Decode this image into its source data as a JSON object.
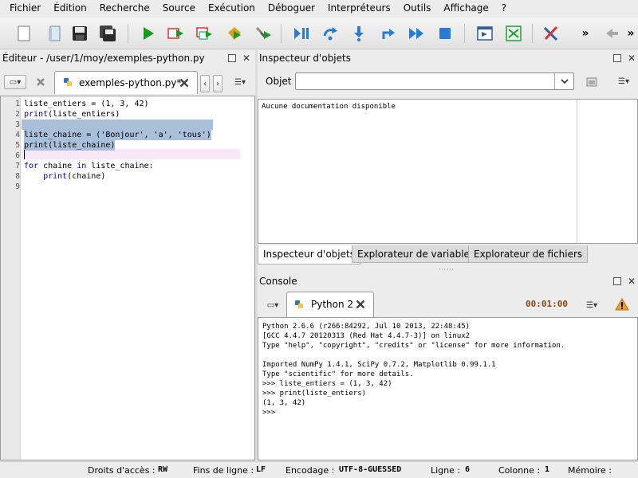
{
  "menubar": {
    "items": [
      "Fichier",
      "Édition",
      "Recherche",
      "Source",
      "Exécution",
      "Déboguer",
      "Interpréteurs",
      "Outils",
      "Affichage",
      "?"
    ]
  },
  "toolbar": {
    "overflow1": "»",
    "overflow2": "»",
    "icons": [
      "new-file-icon",
      "open-file-icon",
      "save-icon",
      "save-all-icon",
      "run-icon",
      "run-cell-icon",
      "run-cell-advance-icon",
      "run-selection-icon",
      "debug-icon",
      "debug-continue-icon",
      "step-icon",
      "step-into-icon",
      "step-return-icon",
      "continue-icon",
      "stop-icon",
      "maximize-icon",
      "pythonpath-icon",
      "tools-icon",
      "back-icon"
    ]
  },
  "editor": {
    "title": "Éditeur - /user/1/moy/exemples-python.py",
    "tab_label": "exemples-python.py*",
    "lines": [
      "1",
      "2",
      "3",
      "4",
      "5",
      "6",
      "7",
      "8",
      "9"
    ],
    "code": {
      "l1": "liste_entiers = (1, 3, 42)",
      "l2a": "print",
      "l2b": "(liste_entiers)",
      "l4": "liste_chaine = ('Bonjour', 'a', 'tous')",
      "l5": "print(liste_chaine)",
      "l7a": "for",
      "l7b": " chaine ",
      "l7c": "in",
      "l7d": " liste_chaine:",
      "l8a": "    ",
      "l8b": "print",
      "l8c": "(chaine)"
    }
  },
  "inspector": {
    "title": "Inspecteur d'objets",
    "object_label": "Objet",
    "object_value": "",
    "doc_text": "Aucune documentation disponible",
    "tabs": [
      "Inspecteur d'objets",
      "Explorateur de variables",
      "Explorateur de fichiers"
    ]
  },
  "console": {
    "title": "Console",
    "tab_label": "Python 2",
    "timer": "00:01:00",
    "lines": [
      "Python 2.6.6 (r266:84292, Jul 10 2013, 22:48:45)",
      "[GCC 4.4.7 20120313 (Red Hat 4.4.7-3)] on linux2",
      "Type \"help\", \"copyright\", \"credits\" or \"license\" for more information.",
      "",
      "Imported NumPy 1.4.1, SciPy 0.7.2, Matplotlib 0.99.1.1",
      "Type \"scientific\" for more details.",
      ">>> liste_entiers = (1, 3, 42)",
      ">>> print(liste_entiers)",
      "(1, 3, 42)",
      ">>> "
    ]
  },
  "statusbar": {
    "access_label": "Droits d'accès :",
    "access_value": "RW",
    "eol_label": "Fins de ligne :",
    "eol_value": "LF",
    "encoding_label": "Encodage :",
    "encoding_value": "UTF-8-GUESSED",
    "line_label": "Ligne :",
    "line_value": "6",
    "col_label": "Colonne :",
    "col_value": "1",
    "mem_label": "Mémoire :"
  },
  "colors": {
    "selection": "#aabfd9",
    "keyword": "#0000c0",
    "timer": "#8b4513",
    "run_green": "#1a9a1a"
  }
}
